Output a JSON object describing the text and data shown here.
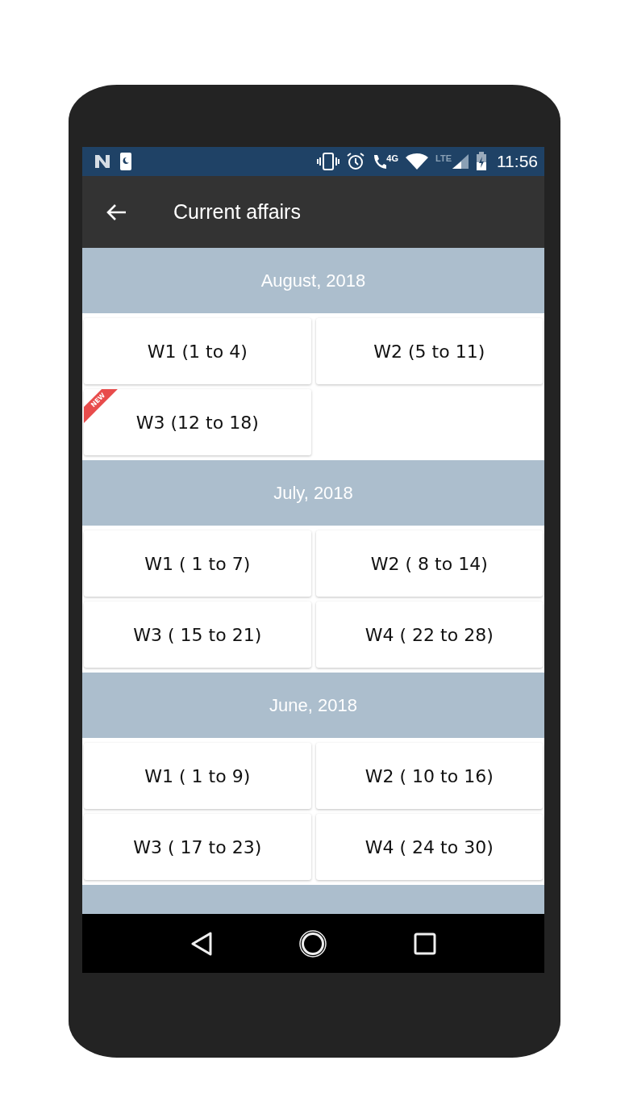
{
  "status_bar": {
    "time": "11:56",
    "network_label": "4G",
    "lte_label": "LTE"
  },
  "app_bar": {
    "title": "Current affairs"
  },
  "sections": [
    {
      "title": "August, 2018",
      "weeks": [
        {
          "label": "W1 (1 to 4)",
          "is_new": false
        },
        {
          "label": "W2 (5 to 11)",
          "is_new": false
        },
        {
          "label": "W3 (12 to 18)",
          "is_new": true
        }
      ]
    },
    {
      "title": "July, 2018",
      "weeks": [
        {
          "label": "W1 ( 1 to 7)",
          "is_new": false
        },
        {
          "label": "W2 ( 8 to 14)",
          "is_new": false
        },
        {
          "label": "W3 ( 15 to 21)",
          "is_new": false
        },
        {
          "label": "W4 ( 22 to 28)",
          "is_new": false
        }
      ]
    },
    {
      "title": "June, 2018",
      "weeks": [
        {
          "label": "W1 ( 1 to 9)",
          "is_new": false
        },
        {
          "label": "W2 ( 10 to 16)",
          "is_new": false
        },
        {
          "label": "W3 ( 17 to 23)",
          "is_new": false
        },
        {
          "label": "W4 ( 24 to 30)",
          "is_new": false
        }
      ]
    }
  ],
  "new_badge": "NEW"
}
